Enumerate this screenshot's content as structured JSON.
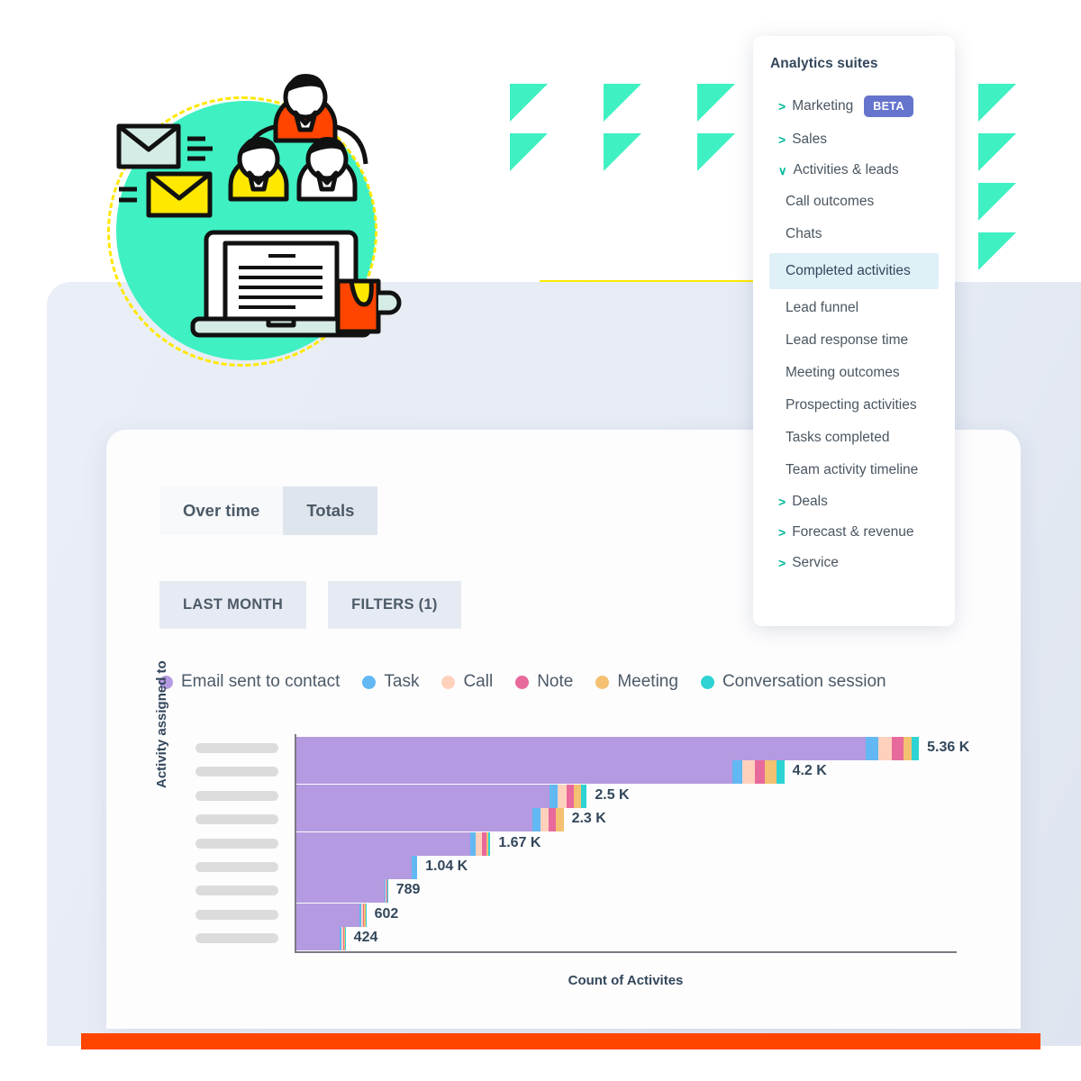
{
  "menu": {
    "title": "Analytics suites",
    "groups_top": [
      {
        "label": "Marketing",
        "chevron": "chevron-right-icon",
        "badge": "BETA"
      },
      {
        "label": "Sales",
        "chevron": "chevron-right-icon",
        "badge": ""
      },
      {
        "label": "Activities & leads",
        "chevron": "chevron-down-icon",
        "badge": ""
      }
    ],
    "items": [
      {
        "label": "Call outcomes",
        "selected": false
      },
      {
        "label": "Chats",
        "selected": false
      },
      {
        "label": "Completed activities",
        "selected": true
      },
      {
        "label": "Lead funnel",
        "selected": false
      },
      {
        "label": "Lead response time",
        "selected": false
      },
      {
        "label": "Meeting outcomes",
        "selected": false
      },
      {
        "label": "Prospecting activities",
        "selected": false
      },
      {
        "label": "Tasks completed",
        "selected": false
      },
      {
        "label": "Team activity timeline",
        "selected": false
      }
    ],
    "groups_bottom": [
      {
        "label": "Deals",
        "chevron": "chevron-right-icon"
      },
      {
        "label": "Forecast & revenue",
        "chevron": "chevron-right-icon"
      },
      {
        "label": "Service",
        "chevron": "chevron-right-icon"
      }
    ],
    "accent_chevron_color": "#00b899",
    "badge_color": "#6574cd",
    "selected_bg": "#dff0f7"
  },
  "toolbar": {
    "tabs": [
      {
        "label": "Over time",
        "active": false
      },
      {
        "label": "Totals",
        "active": true
      }
    ],
    "filter_buttons": [
      {
        "label": "LAST MONTH"
      },
      {
        "label": "FILTERS (1)"
      }
    ]
  },
  "chart_data": {
    "type": "bar",
    "orientation": "horizontal",
    "stacked": true,
    "title": "",
    "xlabel": "Count of Activites",
    "ylabel": "Activity assigned to",
    "grid": false,
    "legend_position": "top",
    "categories": [
      "",
      "",
      "",
      "",
      "",
      "",
      "",
      "",
      ""
    ],
    "category_placeholder": "redacted-name-pill",
    "value_labels": [
      "5.36 K",
      "4.2 K",
      "2.5 K",
      "2.3 K",
      "1.67 K",
      "1.04 K",
      "789",
      "602",
      "424"
    ],
    "totals": [
      5360,
      4200,
      2500,
      2300,
      1670,
      1040,
      789,
      602,
      424
    ],
    "xlim": [
      0,
      5700
    ],
    "series": [
      {
        "name": "Email sent to contact",
        "color": "#b49ae0",
        "values": [
          4900,
          3750,
          2180,
          2030,
          1500,
          990,
          760,
          540,
          375
        ]
      },
      {
        "name": "Task",
        "color": "#62b8f2",
        "values": [
          110,
          90,
          70,
          70,
          40,
          50,
          10,
          18,
          14
        ]
      },
      {
        "name": "Call",
        "color": "#ffd1bd",
        "values": [
          120,
          105,
          75,
          70,
          55,
          0,
          8,
          14,
          12
        ]
      },
      {
        "name": "Note",
        "color": "#e8699b",
        "values": [
          100,
          90,
          65,
          60,
          40,
          0,
          5,
          12,
          10
        ]
      },
      {
        "name": "Meeting",
        "color": "#f4c071",
        "values": [
          70,
          95,
          60,
          70,
          20,
          0,
          4,
          10,
          8
        ]
      },
      {
        "name": "Conversation session",
        "color": "#2ed3d3",
        "values": [
          60,
          70,
          50,
          0,
          15,
          0,
          2,
          8,
          5
        ]
      }
    ]
  },
  "illustration": {
    "name": "email-team-laptop-illustration",
    "blob_color": "#3ff0c2",
    "ring_color": "#ffe800",
    "envelope_primary_color": "#ffe800",
    "mug_color": "#ff4500"
  },
  "decor": {
    "triangle_color": "#3ff0c2",
    "yellow_bar_color": "#ffe800",
    "orange_bar_color": "#ff4500",
    "backdrop_color": "#e8ecf5"
  }
}
